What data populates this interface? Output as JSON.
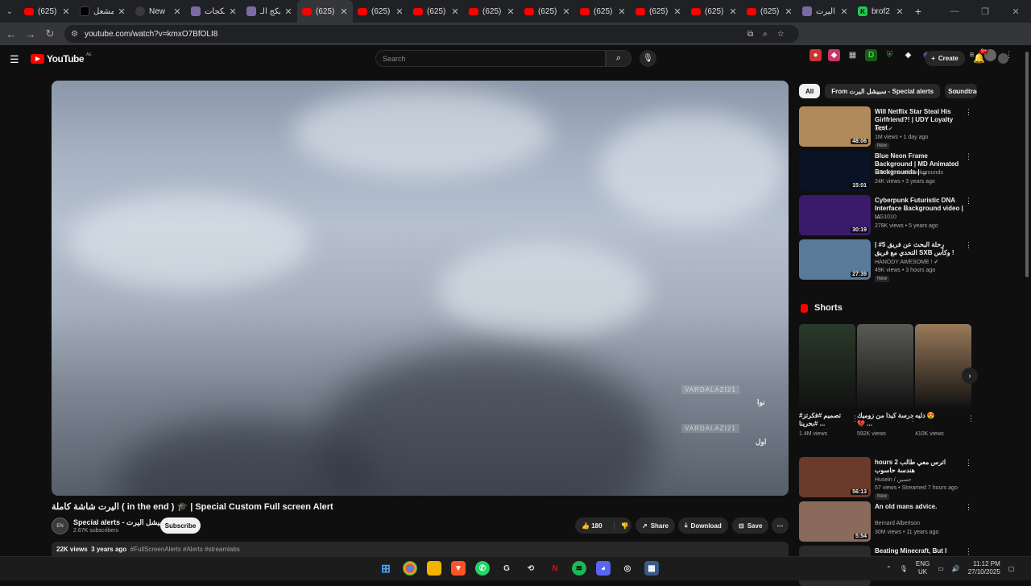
{
  "browser": {
    "tabs": [
      {
        "title": "(625)",
        "favicon": "youtube-icon"
      },
      {
        "title": "مشعل",
        "favicon": "tiktok-icon"
      },
      {
        "title": "New",
        "favicon": "globe-icon"
      },
      {
        "title": "بكجات",
        "favicon": "image-icon"
      },
      {
        "title": "بكج الـ",
        "favicon": "image-icon"
      },
      {
        "title": "(625)",
        "favicon": "youtube-icon",
        "active": true
      },
      {
        "title": "(625)",
        "favicon": "youtube-icon"
      },
      {
        "title": "(625)",
        "favicon": "youtube-icon"
      },
      {
        "title": "(625)",
        "favicon": "youtube-icon"
      },
      {
        "title": "(625)",
        "favicon": "youtube-icon"
      },
      {
        "title": "(625)",
        "favicon": "youtube-icon"
      },
      {
        "title": "(625)",
        "favicon": "youtube-icon"
      },
      {
        "title": "(625)",
        "favicon": "youtube-icon"
      },
      {
        "title": "(625)",
        "favicon": "youtube-icon"
      },
      {
        "title": "اليرت",
        "favicon": "image-icon"
      },
      {
        "title": "brof2",
        "favicon": "kick-icon"
      }
    ],
    "url": "youtube.com/watch?v=kmxO7BfOLI8"
  },
  "youtube": {
    "logo_text": "YouTube",
    "logo_country": "AE",
    "search_placeholder": "Search",
    "create_label": "Create",
    "notif_badge": "9+"
  },
  "video": {
    "overlay_tags": [
      "VARDALAZI21",
      "VARDALAZI21"
    ],
    "overlay_arabic": [
      "نوا",
      "اول"
    ],
    "title": "اليرت شاشة كاملة ( in the end ) 🎓 | Special Custom Full screen Alert",
    "channel_name": "Special alerts - سبيشل اليرت",
    "channel_avatar": "EN",
    "subscribers": "2.67K subscribers",
    "subscribe_label": "Subscribe",
    "likes": "180",
    "share_label": "Share",
    "download_label": "Download",
    "save_label": "Save",
    "views": "22K views",
    "age": "3 years ago",
    "hashtags": "#FullScreenAlerts #Alerts #streamlabs"
  },
  "chips": [
    "All",
    "From سبيشل اليرت - Special alerts",
    "Soundtrac"
  ],
  "recommended": [
    {
      "title": "Will Netflix Star Steal His Girlfriend?! | UDY Loyalty Test",
      "channel": "UDY ✔",
      "meta": "1M views • 1 day ago",
      "duration": "48:06",
      "badge": "New",
      "thumb_color": "#b08a5a"
    },
    {
      "title": "Blue Neon Frame Background | MD Animated Backgrounds | ...",
      "channel": "MD Animated Backgrounds",
      "meta": "24K views • 3 years ago",
      "duration": "15:01",
      "badge": "",
      "thumb_color": "#0a1226"
    },
    {
      "title": "Cyberpunk Futuristic DNA Interface Background video | ...",
      "channel": "MG1010",
      "meta": "278K views • 5 years ago",
      "duration": "30:19",
      "badge": "",
      "thumb_color": "#3a1a6a"
    },
    {
      "title": "رحلة البحث عن فريق 5# | التحدي مع فريق SXB وكأس !",
      "channel": "HANODY AWESOME ! ✔",
      "meta": "49K views • 3 hours ago",
      "duration": "27:39",
      "badge": "New",
      "thumb_color": "#5a7a9a"
    }
  ],
  "shorts": {
    "heading": "Shorts",
    "items": [
      {
        "title": "#تصميم #فكرتز #بحرينا ...",
        "views": "1.4M views",
        "color": "#2a3a2a"
      },
      {
        "title": "درسة كيذا من زوميك 💔 ...",
        "views": "592K views",
        "color": "#5a5a55"
      },
      {
        "title": "دليه 😍",
        "views": "410K views",
        "color": "#9a7a5a"
      }
    ]
  },
  "recommended2": [
    {
      "title": "hours 2 اترس معي طالب هندسة حاسوب",
      "channel": "Husein / حسين",
      "meta": "57 views • Streamed 7 hours ago",
      "duration": "56:13",
      "badge": "New",
      "thumb_color": "#6a3a2a"
    },
    {
      "title": "An old mans advice.",
      "channel": "Bernard Albertson",
      "meta": "30M views • 11 years ago",
      "duration": "5:54",
      "badge": "",
      "thumb_color": "#8a6a5a"
    },
    {
      "title": "Beating Minecraft, But I Can't",
      "channel": "",
      "meta": "",
      "duration": "",
      "badge": "",
      "thumb_color": "#2a2a2a"
    }
  ],
  "taskbar": {
    "lang_top": "ENG",
    "lang_bottom": "UK",
    "time": "11:12 PM",
    "date": "27/10/2025"
  }
}
